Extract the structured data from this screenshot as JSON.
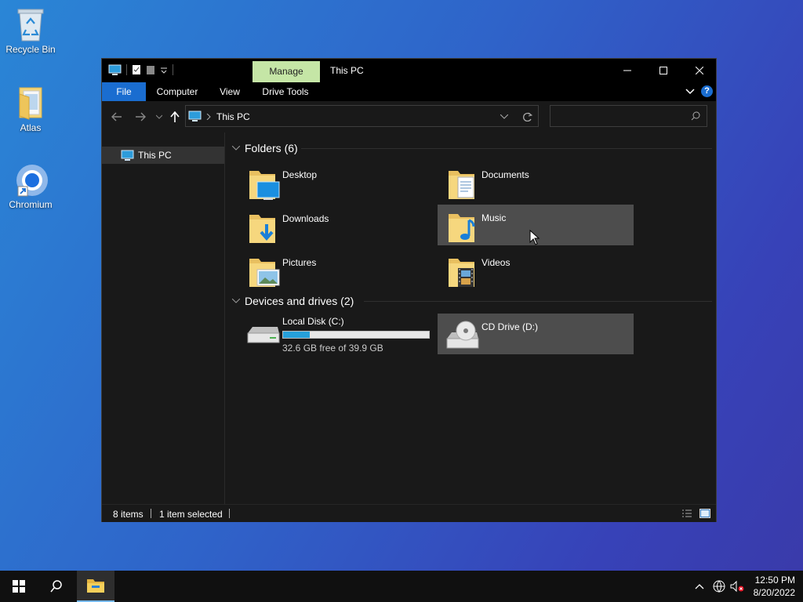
{
  "desktop": {
    "icons": [
      {
        "label": "Recycle Bin"
      },
      {
        "label": "Atlas"
      },
      {
        "label": "Chromium"
      }
    ]
  },
  "window": {
    "title": "This PC",
    "manage_tab": "Manage",
    "ribbon_tabs": [
      "File",
      "Computer",
      "View",
      "Drive Tools"
    ],
    "address": {
      "path": "This PC",
      "search_placeholder": ""
    },
    "nav_pane": {
      "items": [
        {
          "label": "This PC"
        }
      ]
    },
    "groups": {
      "folders": {
        "header": "Folders (6)",
        "items": [
          "Desktop",
          "Documents",
          "Downloads",
          "Music",
          "Pictures",
          "Videos"
        ]
      },
      "drives": {
        "header": "Devices and drives (2)"
      }
    },
    "drives": [
      {
        "label": "Local Disk (C:)",
        "free_text": "32.6 GB free of 39.9 GB",
        "used_fraction": 0.183
      },
      {
        "label": "CD Drive (D:)"
      }
    ],
    "status": {
      "items": "8 items",
      "selected": "1 item selected"
    }
  },
  "taskbar": {
    "clock_time": "12:50 PM",
    "clock_date": "8/20/2022"
  },
  "colors": {
    "accent": "#1a6dd0",
    "manage_tab": "#c5e6a6",
    "drive_fill": "#26a0da",
    "selection": "#4d4d4d"
  }
}
